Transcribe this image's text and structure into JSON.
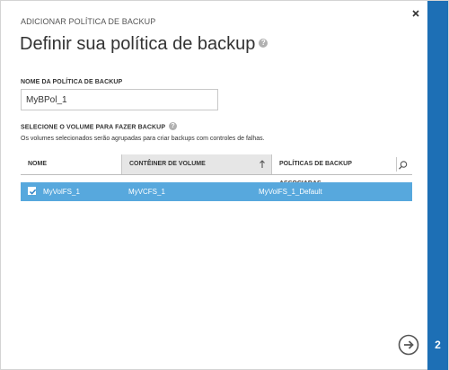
{
  "dialog": {
    "caption": "ADICIONAR POLÍTICA DE BACKUP",
    "title": "Definir sua política de backup",
    "help_icon": "question-circle-icon",
    "close_icon": "close-icon",
    "step_number": "2"
  },
  "policy_name": {
    "label": "NOME DA POLÍTICA DE BACKUP",
    "value": "MyBPol_1"
  },
  "volumes": {
    "label": "SELECIONE O VOLUME PARA FAZER BACKUP",
    "description": "Os volumes selecionados serão agrupadas para criar backups com controles de falhas.",
    "columns": {
      "name": "NOME",
      "container": "CONTÊINER DE VOLUME",
      "policies": "POLÍTICAS DE BACKUP ASSOCIADAS"
    },
    "sort_icon": "arrow-up-icon",
    "search_icon": "search-icon",
    "rows": [
      {
        "checked": true,
        "name": "MyVolFS_1",
        "container": "MyVCFS_1",
        "policy": "MyVolFS_1_Default"
      }
    ]
  },
  "footer": {
    "next_icon": "arrow-right-circle-icon"
  },
  "colors": {
    "accent": "#1d6fb5",
    "selected_row": "#57a8dd",
    "sorted_column": "#e6e6e6"
  }
}
